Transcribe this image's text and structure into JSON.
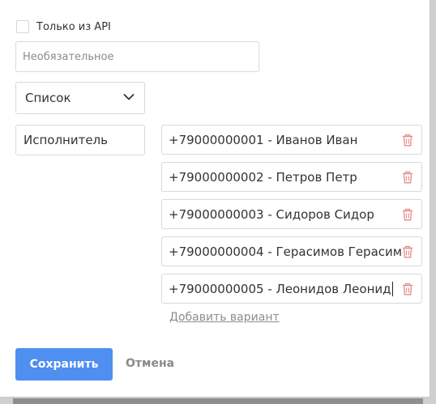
{
  "api_checkbox": {
    "label": "Только из API",
    "checked": false
  },
  "description_input": {
    "placeholder": "Необязательное",
    "value": ""
  },
  "type_select": {
    "value": "Список"
  },
  "field_name": {
    "value": "Исполнитель"
  },
  "options": [
    {
      "label": "+79000000001 - Иванов Иван"
    },
    {
      "label": "+79000000002 - Петров Петр"
    },
    {
      "label": "+79000000003 - Сидоров Сидор"
    },
    {
      "label": "+79000000004 - Герасимов Герасим"
    },
    {
      "label": "+79000000005 - Леонидов Леонид"
    }
  ],
  "add_option_label": "Добавить вариант",
  "buttons": {
    "save": "Сохранить",
    "cancel": "Отмена"
  },
  "icons": {
    "delete": "trash-icon",
    "dropdown": "chevron-down-icon"
  },
  "colors": {
    "primary": "#4e8ff0",
    "danger": "#e58a8a",
    "muted": "#8a8a8a"
  }
}
